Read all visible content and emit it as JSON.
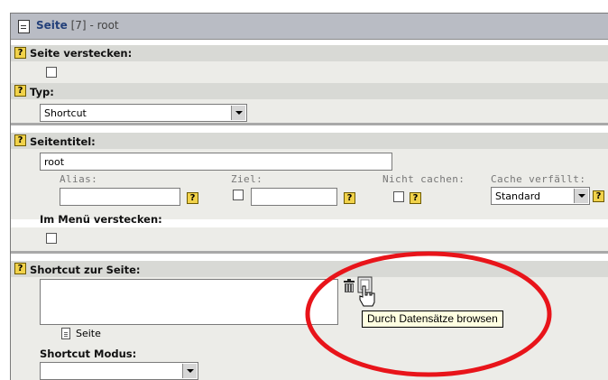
{
  "header": {
    "title": "Seite",
    "id_text": "[7]",
    "suffix": "- root"
  },
  "fields": {
    "hide_page": {
      "label": "Seite verstecken:"
    },
    "type": {
      "label": "Typ:",
      "value": "Shortcut"
    },
    "page_title": {
      "label": "Seitentitel:",
      "value": "root"
    },
    "alias": {
      "label": "Alias:",
      "value": ""
    },
    "target": {
      "label": "Ziel:",
      "value": ""
    },
    "no_cache": {
      "label": "Nicht cachen:"
    },
    "cache_expires": {
      "label": "Cache verfällt:",
      "value": "Standard"
    },
    "hide_in_menu": {
      "label": "Im Menü verstecken:"
    },
    "shortcut_to_page": {
      "label": "Shortcut zur Seite:",
      "element_label": "Seite"
    },
    "shortcut_mode": {
      "label": "Shortcut Modus:",
      "value": ""
    }
  },
  "help_icon_text": "?",
  "tooltip": "Durch Datensätze browsen",
  "icons": [
    "page-icon",
    "help-icon",
    "trash-icon",
    "browse-records-icon",
    "hand-cursor-icon",
    "document-icon"
  ],
  "colors": {
    "annotation_circle": "#e8141a",
    "help_icon": "#f1d24a",
    "header_bg": "#b9bcc4",
    "tooltip_bg": "#ffffe1"
  }
}
